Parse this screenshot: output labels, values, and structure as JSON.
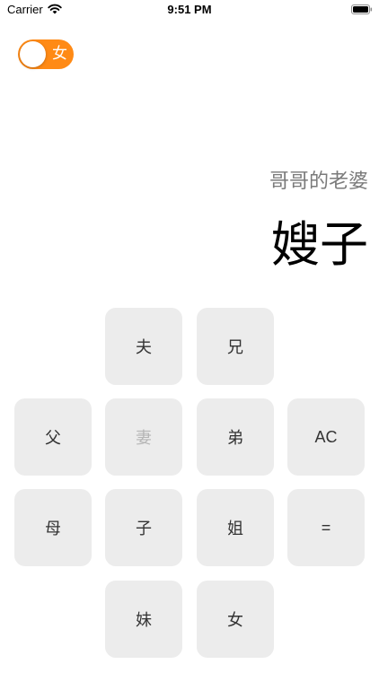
{
  "status_bar": {
    "carrier": "Carrier",
    "time": "9:51 PM",
    "icons": [
      "wifi-icon",
      "battery-icon"
    ]
  },
  "gender_toggle": {
    "label": "女",
    "on": true,
    "color": "#ff8a15"
  },
  "display": {
    "expression": "哥哥的老婆",
    "result": "嫂子"
  },
  "keys": {
    "husband": "夫",
    "elder_brother": "兄",
    "father": "父",
    "wife": "妻",
    "younger_brother": "弟",
    "clear": "AC",
    "mother": "母",
    "son": "子",
    "elder_sister": "姐",
    "equals": "=",
    "younger_sister": "妹",
    "daughter": "女"
  },
  "disabled_keys": [
    "妻"
  ],
  "colors": {
    "accent": "#ff8a15",
    "key_background": "#ececec",
    "key_text": "#333333",
    "disabled_key_text": "#b5b5b5",
    "expression_text": "#7a7a7a"
  }
}
